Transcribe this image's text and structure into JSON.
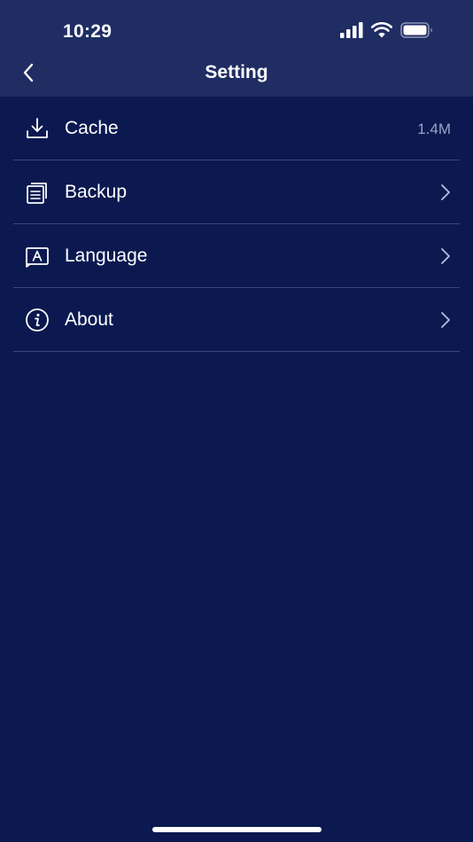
{
  "status_bar": {
    "time": "10:29"
  },
  "nav": {
    "title": "Setting",
    "back_icon": "chevron-left-icon"
  },
  "settings": {
    "items": [
      {
        "label": "Cache",
        "icon": "download-icon",
        "value": "1.4M"
      },
      {
        "label": "Backup",
        "icon": "backup-icon",
        "accessory": "chevron-right-icon"
      },
      {
        "label": "Language",
        "icon": "language-icon",
        "accessory": "chevron-right-icon"
      },
      {
        "label": "About",
        "icon": "info-icon",
        "accessory": "chevron-right-icon"
      }
    ]
  },
  "colors": {
    "background": "#0b1950",
    "header": "#1f2d63",
    "divider": "#3b477a",
    "secondary_text": "#9aa3c4",
    "text": "#ffffff"
  }
}
